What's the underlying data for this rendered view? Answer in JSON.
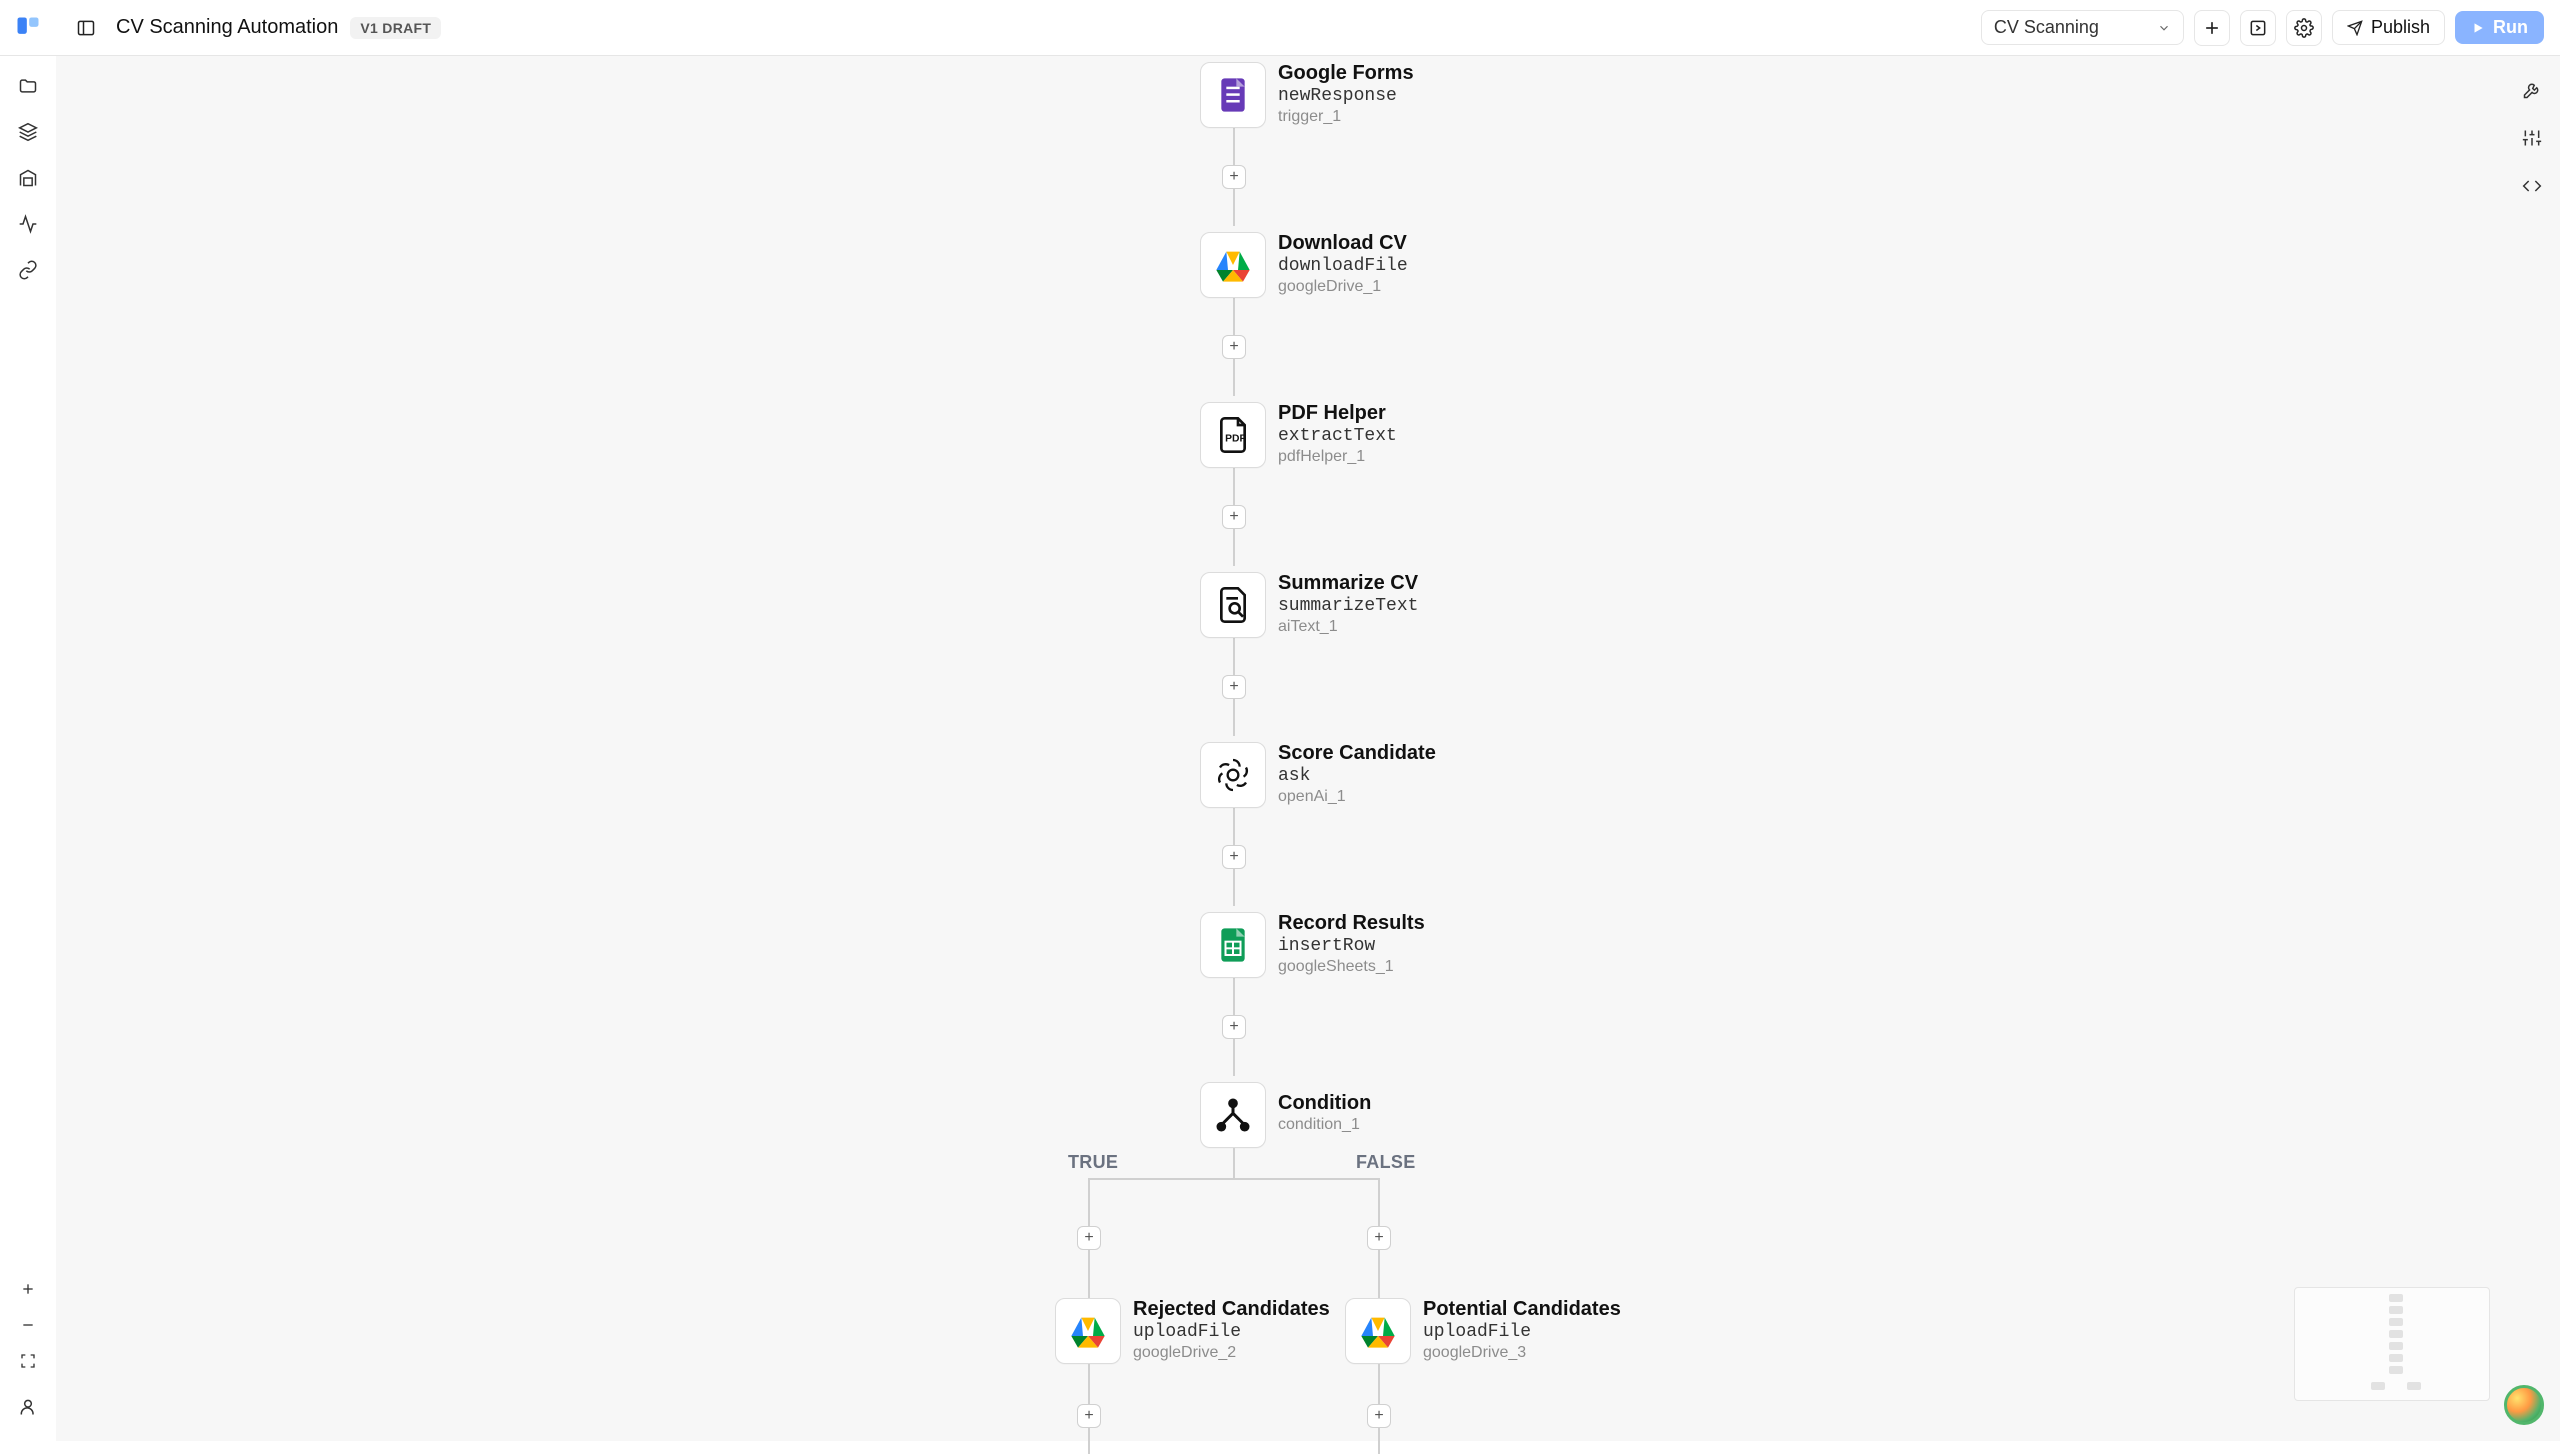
{
  "header": {
    "title": "CV Scanning Automation",
    "version_badge": "V1 DRAFT",
    "dropdown_label": "CV Scanning",
    "publish_label": "Publish",
    "run_label": "Run"
  },
  "branch": {
    "true_label": "TRUE",
    "false_label": "FALSE"
  },
  "nodes": [
    {
      "key": "trigger",
      "title": "Google Forms",
      "action": "newResponse",
      "id": "trigger_1",
      "icon": "google-forms"
    },
    {
      "key": "download",
      "title": "Download CV",
      "action": "downloadFile",
      "id": "googleDrive_1",
      "icon": "google-drive"
    },
    {
      "key": "pdf",
      "title": "PDF Helper",
      "action": "extractText",
      "id": "pdfHelper_1",
      "icon": "pdf"
    },
    {
      "key": "summ",
      "title": "Summarize CV",
      "action": "summarizeText",
      "id": "aiText_1",
      "icon": "doc-search"
    },
    {
      "key": "score",
      "title": "Score Candidate",
      "action": "ask",
      "id": "openAi_1",
      "icon": "openai"
    },
    {
      "key": "record",
      "title": "Record Results",
      "action": "insertRow",
      "id": "googleSheets_1",
      "icon": "google-sheets"
    },
    {
      "key": "cond",
      "title": "Condition",
      "action": "",
      "id": "condition_1",
      "icon": "condition"
    },
    {
      "key": "rej",
      "title": "Rejected Candidates",
      "action": "uploadFile",
      "id": "googleDrive_2",
      "icon": "google-drive"
    },
    {
      "key": "pot",
      "title": "Potential Candidates",
      "action": "uploadFile",
      "id": "googleDrive_3",
      "icon": "google-drive"
    }
  ]
}
